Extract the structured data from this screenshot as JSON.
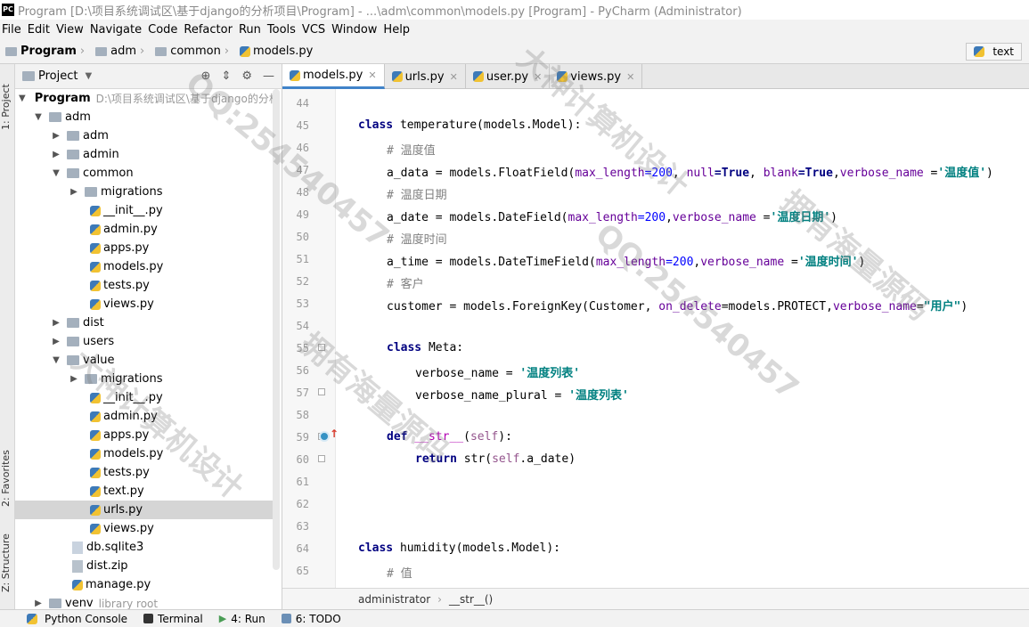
{
  "window": {
    "title": "Program [D:\\项目系统调试区\\基于django的分析项目\\Program] - ...\\adm\\common\\models.py [Program] - PyCharm (Administrator)",
    "logo_text": "PC"
  },
  "menu": [
    "File",
    "Edit",
    "View",
    "Navigate",
    "Code",
    "Refactor",
    "Run",
    "Tools",
    "VCS",
    "Window",
    "Help"
  ],
  "breadcrumb": [
    "Program",
    "adm",
    "common",
    "models.py"
  ],
  "run_config": {
    "label": "text"
  },
  "left_strip": {
    "project": "1: Project",
    "favorites": "2: Favorites",
    "structure": "Z: Structure"
  },
  "project_panel": {
    "title": "Project",
    "root_label": "Program",
    "root_path": "D:\\项目系统调试区\\基于django的分析",
    "items": [
      {
        "label": "adm",
        "type": "folder",
        "expanded": true
      },
      {
        "label": "adm",
        "type": "folder",
        "expanded": false
      },
      {
        "label": "admin",
        "type": "folder",
        "expanded": false
      },
      {
        "label": "common",
        "type": "folder",
        "expanded": true
      },
      {
        "label": "migrations",
        "type": "folder",
        "expanded": false
      },
      {
        "label": "__init__.py",
        "type": "py"
      },
      {
        "label": "admin.py",
        "type": "py"
      },
      {
        "label": "apps.py",
        "type": "py"
      },
      {
        "label": "models.py",
        "type": "py"
      },
      {
        "label": "tests.py",
        "type": "py"
      },
      {
        "label": "views.py",
        "type": "py"
      },
      {
        "label": "dist",
        "type": "folder",
        "expanded": false
      },
      {
        "label": "users",
        "type": "folder",
        "expanded": false
      },
      {
        "label": "value",
        "type": "folder",
        "expanded": true
      },
      {
        "label": "migrations",
        "type": "folder",
        "expanded": false
      },
      {
        "label": "__init__.py",
        "type": "py"
      },
      {
        "label": "admin.py",
        "type": "py"
      },
      {
        "label": "apps.py",
        "type": "py"
      },
      {
        "label": "models.py",
        "type": "py"
      },
      {
        "label": "tests.py",
        "type": "py"
      },
      {
        "label": "text.py",
        "type": "py"
      },
      {
        "label": "urls.py",
        "type": "py"
      },
      {
        "label": "views.py",
        "type": "py"
      },
      {
        "label": "db.sqlite3",
        "type": "db"
      },
      {
        "label": "dist.zip",
        "type": "zip"
      },
      {
        "label": "manage.py",
        "type": "py"
      },
      {
        "label": "venv",
        "type": "folder",
        "expanded": false
      }
    ],
    "venv_note": "library root"
  },
  "tabs": [
    "models.py",
    "urls.py",
    "user.py",
    "views.py"
  ],
  "editor": {
    "line_numbers": [
      "44",
      "45",
      "46",
      "47",
      "48",
      "49",
      "50",
      "51",
      "52",
      "53",
      "54",
      "55",
      "56",
      "57",
      "58",
      "59",
      "60",
      "61",
      "62",
      "63",
      "64",
      "65"
    ],
    "lines": {
      "l45_kw": "class",
      "l45_rest": " temperature(models.Model):",
      "l46": "# 温度值",
      "l47_a": "a_data = models.FloatField(",
      "l47_k1": "max_length",
      "l47_n1": "=200",
      "l47_sep1": ", ",
      "l47_k2": "null",
      "l47_v2": "=True",
      "l47_sep2": ", ",
      "l47_k3": "blank",
      "l47_v3": "=True",
      "l47_sep3": ",",
      "l47_k4": "verbose_name",
      "l47_eq": " =",
      "l47_s": "'温度值'",
      "l47_end": ")",
      "l48": "# 温度日期",
      "l49_a": "a_date = models.DateField(",
      "l49_k1": "max_length",
      "l49_n1": "=200",
      "l49_sep": ",",
      "l49_k2": "verbose_name",
      "l49_eq": " =",
      "l49_s": "'温度日期'",
      "l49_end": ")",
      "l50": "# 温度时间",
      "l51_a": "a_time = models.DateTimeField(",
      "l51_k1": "max_length",
      "l51_n1": "=200",
      "l51_sep": ",",
      "l51_k2": "verbose_name",
      "l51_eq": " =",
      "l51_s": "'温度时间'",
      "l51_end": ")",
      "l52": "# 客户",
      "l53_a": "customer = models.ForeignKey(Customer, ",
      "l53_k1": "on_delete",
      "l53_v1": "=models.PROTECT,",
      "l53_k2": "verbose_name",
      "l53_eq": "=",
      "l53_s": "\"用户\"",
      "l53_end": ")",
      "l55_kw": "class",
      "l55_rest": " Meta:",
      "l56_a": "verbose_name = ",
      "l56_s": "'温度列表'",
      "l57_a": "verbose_name_plural = ",
      "l57_s": "'温度列表'",
      "l59_kw": "def",
      "l59_name": " __str__",
      "l59_p": "(",
      "l59_self": "self",
      "l59_end": "):",
      "l60_kw": "return",
      "l60_a": " str(",
      "l60_self": "self",
      "l60_end": ".a_date)",
      "l64_kw": "class",
      "l64_rest": " humidity(models.Model):",
      "l65": "# 值"
    }
  },
  "editor_breadcrumb": [
    "administrator",
    "__str__()"
  ],
  "bottom_tools": [
    "Python Console",
    "Terminal",
    "4: Run",
    "6: TODO"
  ],
  "watermarks": [
    "大神计算机设计",
    "QQ:254540457",
    "拥有海量源码"
  ]
}
